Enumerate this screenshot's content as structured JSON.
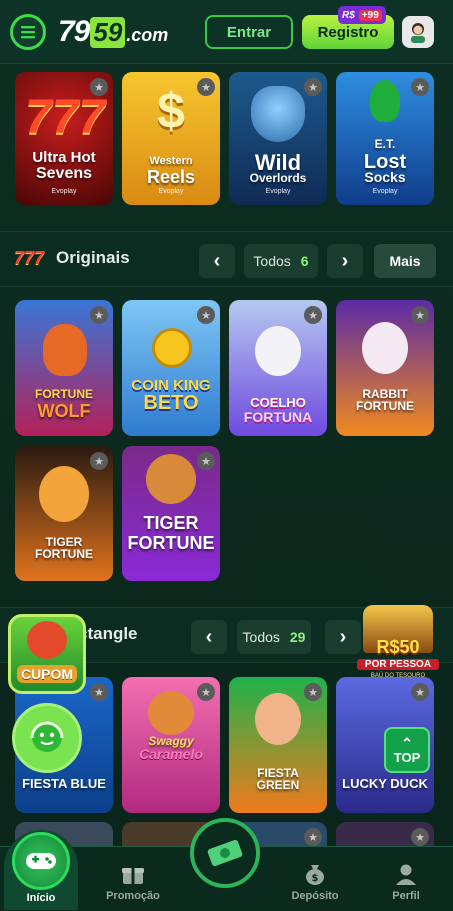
{
  "header": {
    "logo_main": "79",
    "logo_accent": "59",
    "logo_suffix": ".com",
    "login_label": "Entrar",
    "register_label": "Registro",
    "register_badge_currency": "R$",
    "register_badge_count": "+99"
  },
  "top_games": [
    {
      "title_line1": "Ultra Hot",
      "title_line2": "Sevens",
      "provider": "Evoplay"
    },
    {
      "title_line1": "Western",
      "title_line2": "Reels",
      "provider": "Evoplay"
    },
    {
      "title_line1": "Wild",
      "title_line2": "Overlords",
      "provider": "Evoplay"
    },
    {
      "title_line1": "E.T.",
      "title_line2": "Lost",
      "title_line3": "Socks",
      "provider": "Evoplay"
    }
  ],
  "originais": {
    "title": "Originais",
    "all_label": "Todos",
    "count": "6",
    "more_label": "Mais",
    "prev_icon": "‹",
    "next_icon": "›",
    "games": [
      {
        "title_line1": "FORTUNE",
        "title_line2": "WOLF"
      },
      {
        "title_line1": "COIN KING",
        "title_line2": "BETO"
      },
      {
        "title_line1": "COELHO",
        "title_line2": "FORTUNA"
      },
      {
        "title_line1": "RABBIT",
        "title_line2": "FORTUNE"
      },
      {
        "title_line1": "TIGER",
        "title_line2": "FORTUNE"
      },
      {
        "title_line1": "TIGER",
        "title_line2": "FORTUNE"
      }
    ]
  },
  "rectangle_section": {
    "title": "ctangle",
    "all_label": "Todos",
    "count": "29",
    "prev_icon": "‹",
    "next_icon": "›",
    "games": [
      {
        "title_line1": "FIESTA BLUE"
      },
      {
        "title_line1": "Swaggy",
        "title_line2": "Caramelo"
      },
      {
        "title_line1": "FIESTA",
        "title_line2": "GREEN"
      },
      {
        "title_line1": "LUCKY DUCK"
      }
    ]
  },
  "floating": {
    "cupom_label": "CUPOM",
    "promo_value": "R$50",
    "promo_sub": "POR PESSOA",
    "promo_tiny": "BAÚ DO TESOURO",
    "top_label": "TOP"
  },
  "bottom_nav": {
    "home": "Início",
    "promo": "Promoção",
    "deposit": "Depósito",
    "profile": "Perfil"
  },
  "colors": {
    "background": "#0c2a1f",
    "accent": "#3ddc4a",
    "register": "#8be63c"
  }
}
